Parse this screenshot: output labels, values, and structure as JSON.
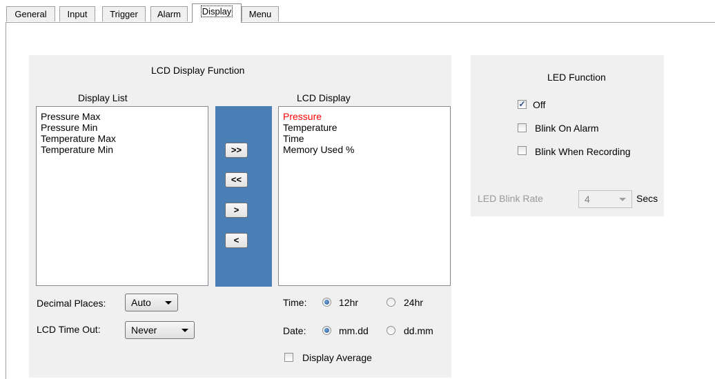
{
  "tabs": {
    "general": "General",
    "input": "Input",
    "trigger": "Trigger",
    "alarm": "Alarm",
    "display": "Display",
    "menu": "Menu"
  },
  "lcd_panel": {
    "title": "LCD Display Function",
    "display_list_header": "Display List",
    "lcd_display_header": "LCD Display",
    "display_list_items": [
      "Pressure Max",
      "Pressure Min",
      "Temperature Max",
      "Temperature Min"
    ],
    "lcd_display_items": [
      "Pressure",
      "Temperature",
      "Time",
      "Memory Used %"
    ],
    "selected_color": "#ff0000",
    "move_all_right": ">>",
    "move_all_left": "<<",
    "move_right": ">",
    "move_left": "<",
    "transfer_bar_color": "#4a7fb5",
    "decimal_places_label": "Decimal Places:",
    "decimal_places_value": "Auto",
    "lcd_timeout_label": "LCD Time Out:",
    "lcd_timeout_value": "Never",
    "time_label": "Time:",
    "time_12hr": "12hr",
    "time_24hr": "24hr",
    "date_label": "Date:",
    "date_mmdd": "mm.dd",
    "date_ddmm": "dd.mm",
    "display_average_label": "Display Average"
  },
  "led_panel": {
    "title": "LED Function",
    "off_label": "Off",
    "blink_on_alarm_label": "Blink On Alarm",
    "blink_when_recording_label": "Blink When Recording",
    "blink_rate_label": "LED Blink Rate",
    "blink_rate_value": "4",
    "secs_label": "Secs"
  }
}
